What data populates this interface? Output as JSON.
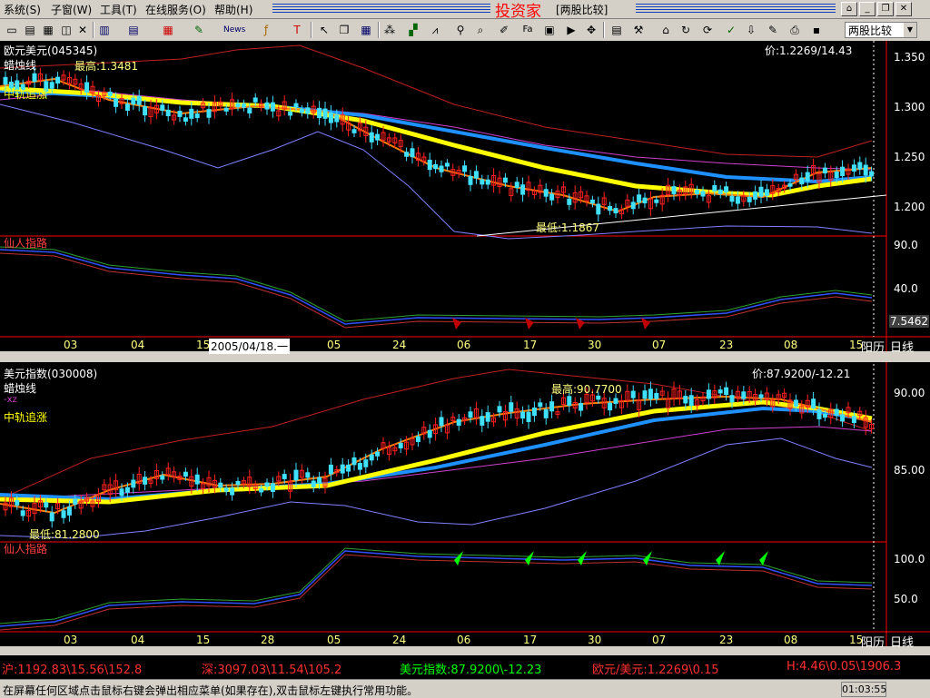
{
  "menu": {
    "items": [
      "系统(S)",
      "子窗(W)",
      "工具(T)",
      "在线服务(O)",
      "帮助(H)"
    ]
  },
  "app": {
    "title": "投资家",
    "subtitle": "[两股比较]"
  },
  "toolbar": {
    "mode": "两股比较"
  },
  "chart1": {
    "name": "欧元美元(045345)",
    "indicator1": "蜡烛线",
    "indicator2": "中轨追涨",
    "high_label": "最高:1.3481",
    "low_label": "最低:1.1867",
    "price_label": "价:1.2269/14.43",
    "y_ticks": [
      "1.350",
      "1.300",
      "1.250",
      "1.200"
    ],
    "sub_title": "仙人指路",
    "sub_ticks": [
      "90.0",
      "40.0"
    ],
    "sub_value": "7.5462",
    "date_tooltip": "2005/04/18.一"
  },
  "chart2": {
    "name": "美元指数(030008)",
    "indicator1": "蜡烛线",
    "indicator_xz": "-xz",
    "indicator2": "中轨追涨",
    "high_label": "最高:90.7700",
    "low_label": "最低:81.2800",
    "price_label": "价:87.9200/-12.21",
    "y_ticks": [
      "90.00",
      "85.00"
    ],
    "sub_title": "仙人指路",
    "sub_ticks": [
      "100.0",
      "50.0"
    ]
  },
  "x_ticks": [
    "03",
    "04",
    "15",
    "05",
    "24",
    "06",
    "17",
    "30",
    "07",
    "23",
    "08",
    "15"
  ],
  "x_tick_labels_2": [
    "03",
    "04",
    "15",
    "28",
    "05",
    "24",
    "06",
    "17",
    "30",
    "07",
    "23",
    "08",
    "15"
  ],
  "axis_mode": {
    "label1": "阳历",
    "label2": "日线"
  },
  "ticker": [
    {
      "label": "沪:1192.83\\15.56\\152.8",
      "color": "#ff3030"
    },
    {
      "label": "深:3097.03\\11.54\\105.2",
      "color": "#ff3030"
    },
    {
      "label": "美元指数:87.9200\\-12.23",
      "color": "#00ff00"
    },
    {
      "label": "欧元/美元:1.2269\\0.15",
      "color": "#ff3030"
    },
    {
      "label": "H:4.46\\0.05\\1906.3",
      "color": "#ff3030"
    }
  ],
  "status": {
    "text": "在屏幕任何区域点击鼠标右键会弹出相应菜单(如果存在),双击鼠标左键执行常用功能。",
    "time": "01:03:55"
  },
  "colors": {
    "up": "#ff2020",
    "down": "#40e0ff",
    "ma_yellow": "#ffff00",
    "ma_orange": "#ff8000",
    "ma_blue": "#1e90ff",
    "band_red": "#c02020",
    "band_blue": "#8080ff",
    "band_magenta": "#d040d0",
    "grid": "#8b0000"
  }
}
